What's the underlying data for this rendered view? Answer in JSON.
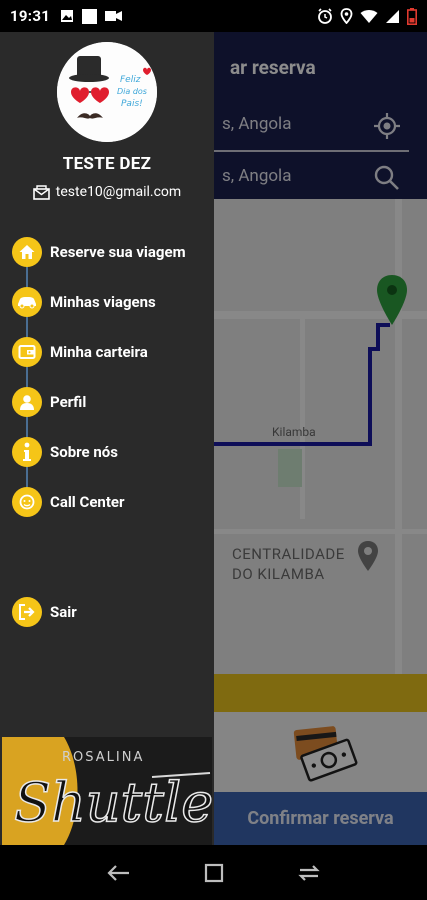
{
  "status_bar": {
    "time": "19:31",
    "left_icons": [
      "image-icon",
      "square-notification-icon",
      "video-icon"
    ],
    "right_icons": [
      "alarm-icon",
      "location-icon",
      "wifi-icon",
      "signal-icon",
      "battery-icon"
    ]
  },
  "background_app": {
    "title_partial": "ar reserva",
    "origin_partial": "s, Angola",
    "destination_partial": "s, Angola",
    "map_labels": {
      "place": "Kilamba",
      "district_line1": "CENTRALIDADE",
      "district_line2": "DO KILAMBA"
    },
    "confirm_button": "Confirmar reserva"
  },
  "drawer": {
    "user_name": "TESTE DEZ",
    "user_email": "teste10@gmail.com",
    "avatar_text_lines": [
      "Feliz",
      "Dia dos",
      "Pais!"
    ],
    "menu": [
      {
        "label": "Reserve sua viagem",
        "icon": "home-icon"
      },
      {
        "label": "Minhas viagens",
        "icon": "car-icon"
      },
      {
        "label": "Minha carteira",
        "icon": "wallet-icon"
      },
      {
        "label": "Perfil",
        "icon": "user-icon"
      },
      {
        "label": "Sobre nós",
        "icon": "info-icon"
      },
      {
        "label": "Call Center",
        "icon": "headset-icon"
      }
    ],
    "logout": {
      "label": "Sair",
      "icon": "logout-icon"
    },
    "logo_text_top": "ROSALINA",
    "logo_text_main": "Shuttle"
  },
  "colors": {
    "drawer_bg": "#2a2a2a",
    "accent_yellow": "#f5c518",
    "topbar_navy": "#1a1f4d",
    "route_blue": "#1a1aa0",
    "pin_green": "#2e9e3e",
    "confirm_blue": "#3b63b0"
  }
}
